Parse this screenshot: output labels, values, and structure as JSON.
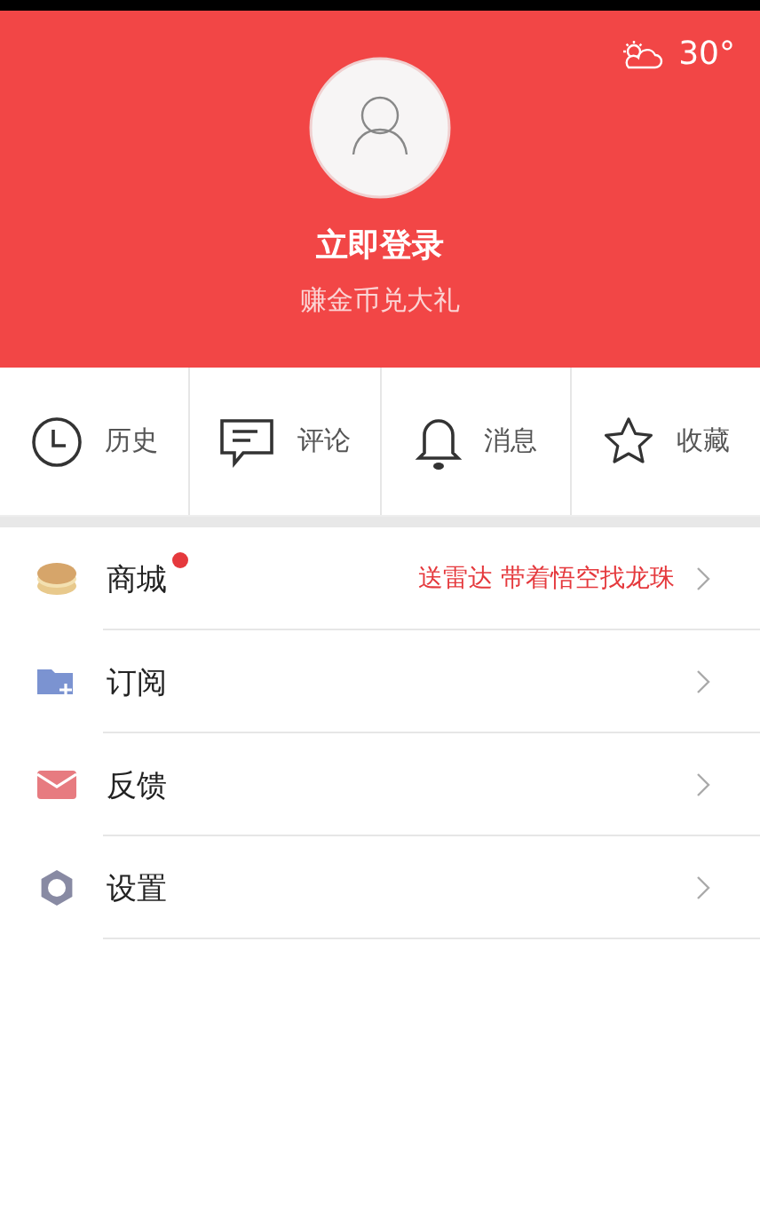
{
  "header": {
    "temperature": "30°",
    "login": "立即登录",
    "subtitle": "赚金币兑大礼"
  },
  "shortcuts": [
    {
      "kind": "history",
      "label": "历史"
    },
    {
      "kind": "comment",
      "label": "评论"
    },
    {
      "kind": "message",
      "label": "消息"
    },
    {
      "kind": "favorite",
      "label": "收藏"
    }
  ],
  "menu": [
    {
      "kind": "mall",
      "label": "商城",
      "badge": true,
      "promo": "送雷达 带着悟空找龙珠"
    },
    {
      "kind": "subscribe",
      "label": "订阅",
      "badge": false
    },
    {
      "kind": "feedback",
      "label": "反馈",
      "badge": false
    },
    {
      "kind": "settings",
      "label": "设置",
      "badge": false
    }
  ]
}
